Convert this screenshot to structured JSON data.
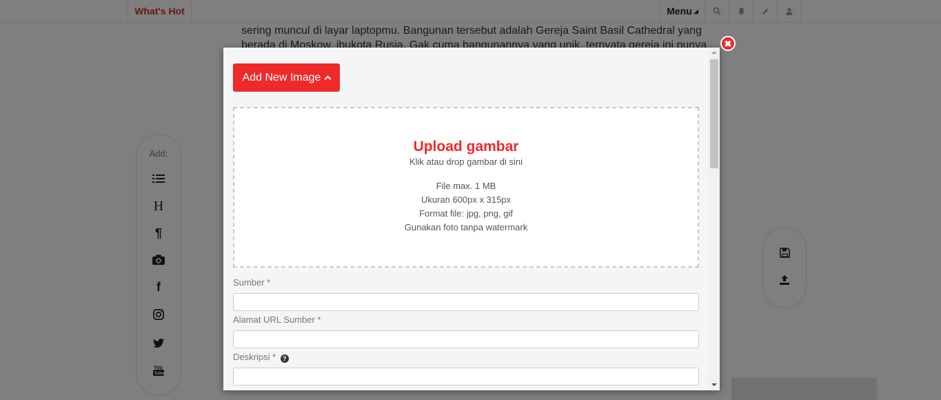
{
  "navbar": {
    "whats_hot": "What's Hot",
    "menu_label": "Menu",
    "icons": [
      "search-icon",
      "bell-icon",
      "pencil-icon",
      "user-icon"
    ]
  },
  "article": {
    "line1": "sering muncul di layar laptopmu. Bangunan tersebut adalah Gereja Saint Basil Cathedral yang",
    "line2": "berada di Moskow, ibukota Rusia. Gak cuma bangunannya yang unik, ternyata gereja ini punya"
  },
  "left_toolbar": {
    "add_label": "Add:",
    "items": [
      "list-icon",
      "heading-icon",
      "paragraph-icon",
      "camera-icon",
      "facebook-icon",
      "instagram-icon",
      "twitter-icon",
      "youtube-icon"
    ]
  },
  "right_toolbar": {
    "items": [
      "save-icon",
      "upload-icon"
    ]
  },
  "modal": {
    "add_button_label": "Add New Image",
    "upload": {
      "title": "Upload gambar",
      "subtitle": "Klik atau drop gambar di sini",
      "info1": "File max. 1 MB",
      "info2": "Ukuran 600px x 315px",
      "info3": "Format file: jpg, png, gif",
      "info4": "Gunakan foto tanpa watermark"
    },
    "fields": {
      "sumber_label": "Sumber *",
      "sumber_value": "",
      "url_label": "Alamat URL Sumber *",
      "url_value": "",
      "deskripsi_label": "Deskripsi *",
      "deskripsi_value": ""
    }
  },
  "colors": {
    "accent": "#ee2a2a",
    "brand_nav": "#d0302a"
  }
}
